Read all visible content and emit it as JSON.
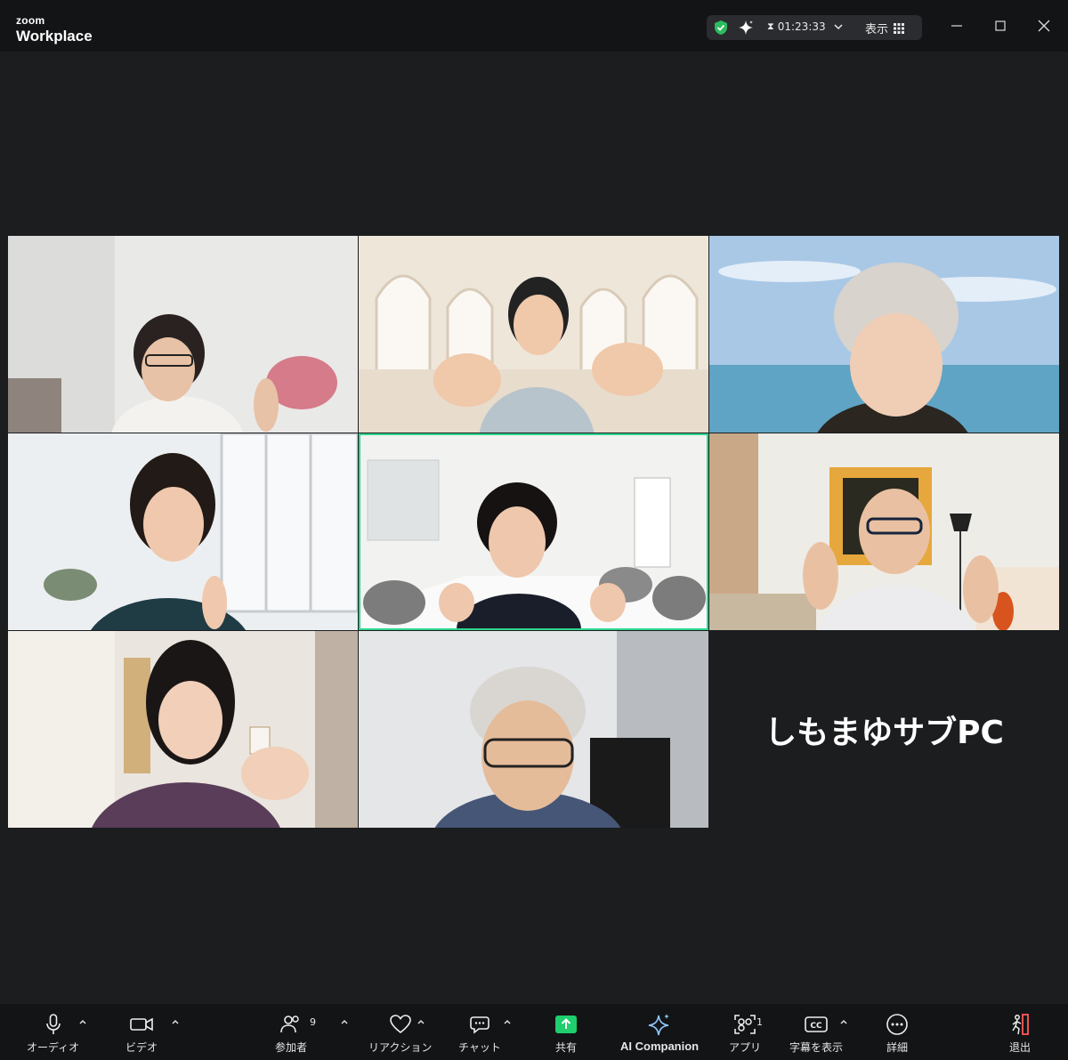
{
  "app": {
    "logo_top": "zoom",
    "logo_bottom": "Workplace"
  },
  "header": {
    "timer": "01:23:33",
    "view_label": "表示"
  },
  "window_controls": [
    "minimize",
    "maximize",
    "close"
  ],
  "name_tile": {
    "label": "しもまゆサブPC"
  },
  "toolbar": {
    "audio": "オーディオ",
    "video": "ビデオ",
    "participants": "参加者",
    "participants_count": "9",
    "reactions": "リアクション",
    "chat": "チャット",
    "share": "共有",
    "ai_companion": "AI Companion",
    "apps": "アプリ",
    "apps_count": "1",
    "captions": "字幕を表示",
    "more": "詳細",
    "leave": "退出"
  },
  "colors": {
    "active_speaker": "#2dd68f",
    "share_green": "#1fce6d",
    "background": "#1b1d1f"
  }
}
